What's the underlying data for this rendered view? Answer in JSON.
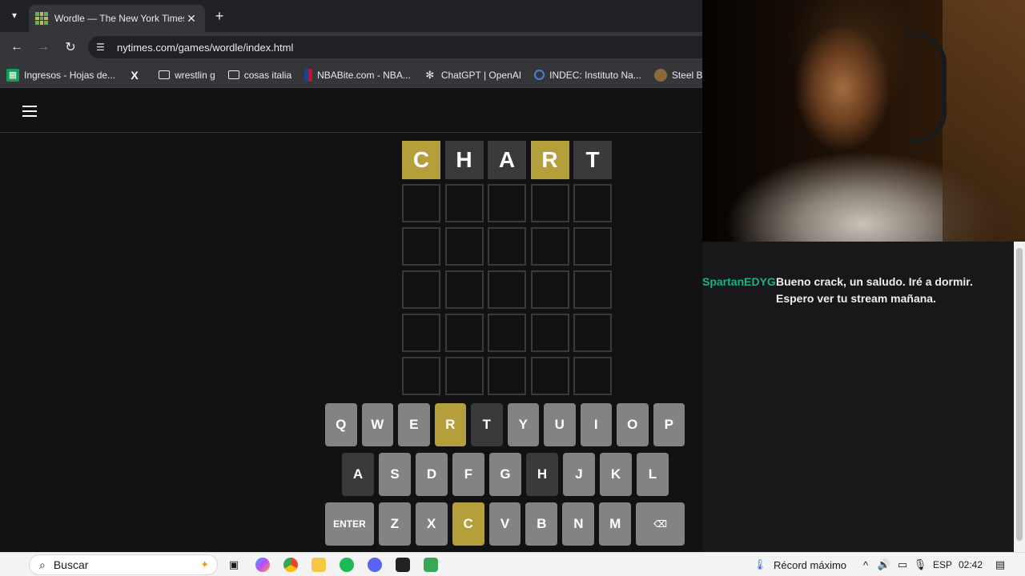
{
  "browser": {
    "tab_title": "Wordle — The New York Times",
    "url": "nytimes.com/games/wordle/index.html",
    "bookmarks": [
      {
        "label": "Ingresos - Hojas de...",
        "icon": "sheets-icon"
      },
      {
        "label": "",
        "icon": "x-icon"
      },
      {
        "label": "wrestlin g",
        "icon": "folder-icon"
      },
      {
        "label": "cosas italia",
        "icon": "folder-icon"
      },
      {
        "label": "NBABite.com - NBA...",
        "icon": "nba-icon"
      },
      {
        "label": "ChatGPT | OpenAI",
        "icon": "openai-icon"
      },
      {
        "label": "INDEC: Instituto Na...",
        "icon": "indec-icon"
      },
      {
        "label": "Steel Ball Run M",
        "icon": "sbr-icon"
      }
    ]
  },
  "wordle": {
    "rows": [
      [
        {
          "letter": "C",
          "state": "present"
        },
        {
          "letter": "H",
          "state": "absent"
        },
        {
          "letter": "A",
          "state": "absent"
        },
        {
          "letter": "R",
          "state": "present"
        },
        {
          "letter": "T",
          "state": "absent"
        }
      ],
      [
        {
          "letter": "",
          "state": "empty"
        },
        {
          "letter": "",
          "state": "empty"
        },
        {
          "letter": "",
          "state": "empty"
        },
        {
          "letter": "",
          "state": "empty"
        },
        {
          "letter": "",
          "state": "empty"
        }
      ],
      [
        {
          "letter": "",
          "state": "empty"
        },
        {
          "letter": "",
          "state": "empty"
        },
        {
          "letter": "",
          "state": "empty"
        },
        {
          "letter": "",
          "state": "empty"
        },
        {
          "letter": "",
          "state": "empty"
        }
      ],
      [
        {
          "letter": "",
          "state": "empty"
        },
        {
          "letter": "",
          "state": "empty"
        },
        {
          "letter": "",
          "state": "empty"
        },
        {
          "letter": "",
          "state": "empty"
        },
        {
          "letter": "",
          "state": "empty"
        }
      ],
      [
        {
          "letter": "",
          "state": "empty"
        },
        {
          "letter": "",
          "state": "empty"
        },
        {
          "letter": "",
          "state": "empty"
        },
        {
          "letter": "",
          "state": "empty"
        },
        {
          "letter": "",
          "state": "empty"
        }
      ],
      [
        {
          "letter": "",
          "state": "empty"
        },
        {
          "letter": "",
          "state": "empty"
        },
        {
          "letter": "",
          "state": "empty"
        },
        {
          "letter": "",
          "state": "empty"
        },
        {
          "letter": "",
          "state": "empty"
        }
      ]
    ],
    "keyboard": [
      [
        {
          "key": "Q",
          "state": "unused"
        },
        {
          "key": "W",
          "state": "unused"
        },
        {
          "key": "E",
          "state": "unused"
        },
        {
          "key": "R",
          "state": "present"
        },
        {
          "key": "T",
          "state": "absent"
        },
        {
          "key": "Y",
          "state": "unused"
        },
        {
          "key": "U",
          "state": "unused"
        },
        {
          "key": "I",
          "state": "unused"
        },
        {
          "key": "O",
          "state": "unused"
        },
        {
          "key": "P",
          "state": "unused"
        }
      ],
      [
        {
          "key": "A",
          "state": "absent"
        },
        {
          "key": "S",
          "state": "unused"
        },
        {
          "key": "D",
          "state": "unused"
        },
        {
          "key": "F",
          "state": "unused"
        },
        {
          "key": "G",
          "state": "unused"
        },
        {
          "key": "H",
          "state": "absent"
        },
        {
          "key": "J",
          "state": "unused"
        },
        {
          "key": "K",
          "state": "unused"
        },
        {
          "key": "L",
          "state": "unused"
        }
      ],
      [
        {
          "key": "ENTER",
          "state": "unused",
          "wide": true
        },
        {
          "key": "Z",
          "state": "unused"
        },
        {
          "key": "X",
          "state": "unused"
        },
        {
          "key": "C",
          "state": "present"
        },
        {
          "key": "V",
          "state": "unused"
        },
        {
          "key": "B",
          "state": "unused"
        },
        {
          "key": "N",
          "state": "unused"
        },
        {
          "key": "M",
          "state": "unused"
        },
        {
          "key": "⌫",
          "state": "unused",
          "wide": true,
          "icon": "backspace-icon"
        }
      ]
    ],
    "colors": {
      "present": "#b59f3b",
      "absent": "#3a3a3c",
      "unused": "#818384"
    }
  },
  "chat": {
    "messages": [
      {
        "user": "SpartanEDYG",
        "text": "Bueno crack, un saludo. Iré a dormir. Espero ver tu stream mañana.",
        "user_color": "#1db08b"
      }
    ]
  },
  "taskbar": {
    "search_label": "Buscar",
    "notification_text": "Récord máximo",
    "language": "ESP",
    "time": "02:42"
  }
}
